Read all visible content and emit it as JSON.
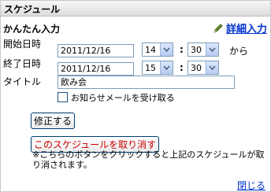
{
  "window": {
    "title": "スケジュール"
  },
  "section_title": "かんたん入力",
  "detail_link": "詳細入力",
  "start": {
    "label": "開始日時",
    "date": "2011/12/16",
    "hour": "14",
    "minute": "30",
    "colon": ":",
    "suffix": "から"
  },
  "end": {
    "label": "終了日時",
    "date": "2011/12/16",
    "hour": "15",
    "minute": "30",
    "colon": ":"
  },
  "title_field": {
    "label": "タイトル",
    "value": "飲み会"
  },
  "notify": {
    "label": "お知らせメールを受け取る",
    "checked": false
  },
  "buttons": {
    "modify": "修正する",
    "cancel": "このスケジュールを取り消す"
  },
  "note": "※こちらのボタンをクリックすると上記のスケジュールが取り消されます。",
  "close_link": "閉じる",
  "icons": {
    "pencil": "pencil-icon",
    "dropdown": "chevron-down-icon"
  },
  "colors": {
    "link": "#0033cc",
    "cancel_text": "#cc0000",
    "border": "#7f9db9"
  }
}
